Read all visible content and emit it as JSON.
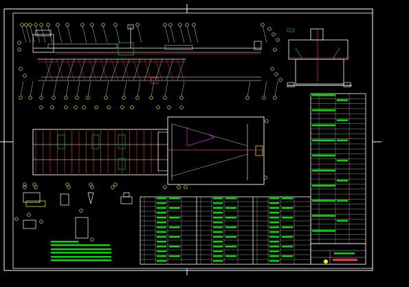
{
  "colors": {
    "background": "#000000",
    "frame": "#ffffff",
    "geometry": "#ffffff",
    "hatch": "#ff3030",
    "callout": "#ffff00",
    "highlight": "#00e000",
    "magenta": "#d020d0",
    "blue": "#4060ff"
  },
  "drawing": {
    "sheet_type": "mechanical assembly drawing",
    "views": [
      "front-elevation",
      "side-elevation",
      "plan-view",
      "detail-parts",
      "technical-notes",
      "parts-list",
      "revision-table",
      "title-block"
    ],
    "text_legible": false
  }
}
